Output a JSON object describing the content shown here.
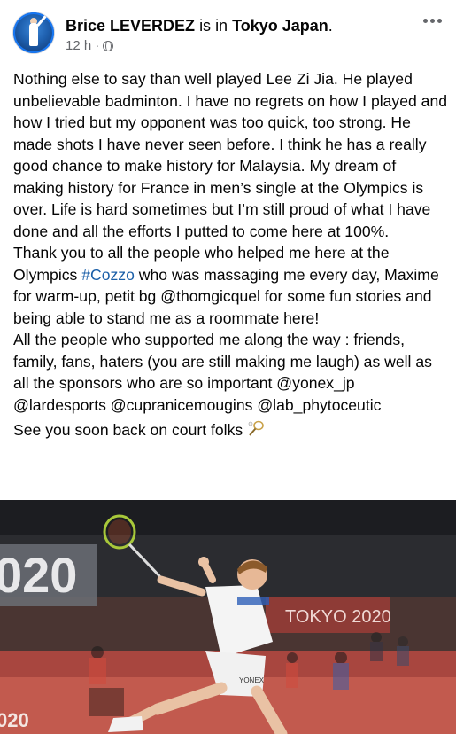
{
  "post": {
    "author": "Brice LEVERDEZ",
    "location_connector": "is in",
    "location": "Tokyo Japan",
    "location_end": ".",
    "timestamp": "12 h",
    "separator": "·",
    "paragraphs": {
      "p1": "Nothing else to say than well played Lee Zi Jia. He played unbelievable badminton. I have no regrets on how I played and how I tried but my opponent was too quick, too strong. He made shots I have never seen before. I think he has a really good chance to make history for Malaysia. My dream of making history for France in men’s single at the Olympics is over. Life is hard sometimes but I’m still proud of what I have done and all the efforts I putted to come here at 100%.",
      "p2_before": "Thank you to all the people who helped me here at the Olympics ",
      "p2_hashtag": "#Cozzo",
      "p2_after": " who was massaging me every day, Maxime for warm-up, petit bg @thomgicquel for some fun stories and being able to stand me as a roommate here!",
      "p3": "All the people who supported me along the way : friends, family, fans, haters (you are still making me laugh) as well as all the sponsors who are so important @yonex_jp @lardesports @cupranicemougins @lab_phytoceutic",
      "p4": "See you soon back on court folks"
    }
  },
  "photo": {
    "banner_left": "020",
    "banner_right": "TOKYO 2020",
    "floor_text": "020",
    "racket_brand": "YONEX"
  }
}
